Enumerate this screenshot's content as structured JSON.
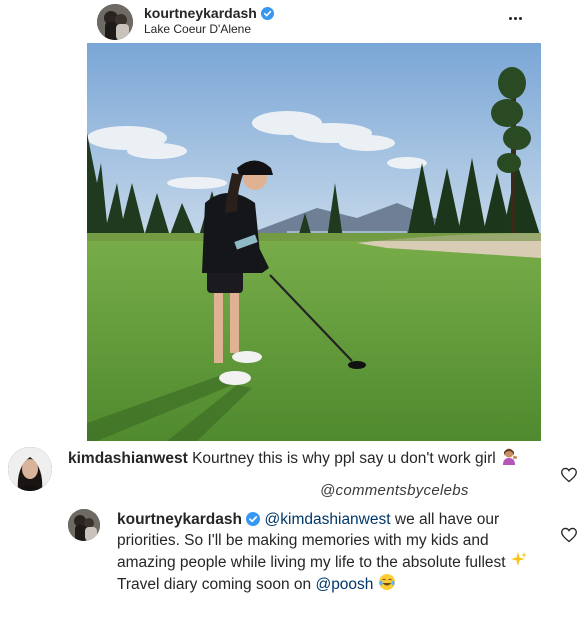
{
  "post": {
    "username": "kourtneykardash",
    "location": "Lake Coeur D'Alene",
    "verified_icon": "verified-badge-icon",
    "more_icon": "more-options-icon"
  },
  "comments": [
    {
      "username": "kimdashianwest",
      "text": "Kourtney this is why ppl say u don't work girl",
      "emoji": "person-tipping-hand-emoji"
    },
    {
      "username": "kourtneykardash",
      "mention": "@kimdashianwest",
      "text": "we all have our priorities. So I'll be making memories with my kids and amazing people while living my life to the absolute fullest",
      "sparkles_emoji": "sparkles-emoji",
      "text2": "Travel diary coming soon on",
      "mention2": "@poosh",
      "laugh_emoji": "tears-of-joy-emoji"
    }
  ],
  "watermark": "@commentsbycelebs",
  "colors": {
    "text": "#262626",
    "verified_blue": "#3897f0",
    "mention_blue": "#00376b",
    "grass": "#5f9a3a",
    "sky": "#8fb6dc"
  }
}
